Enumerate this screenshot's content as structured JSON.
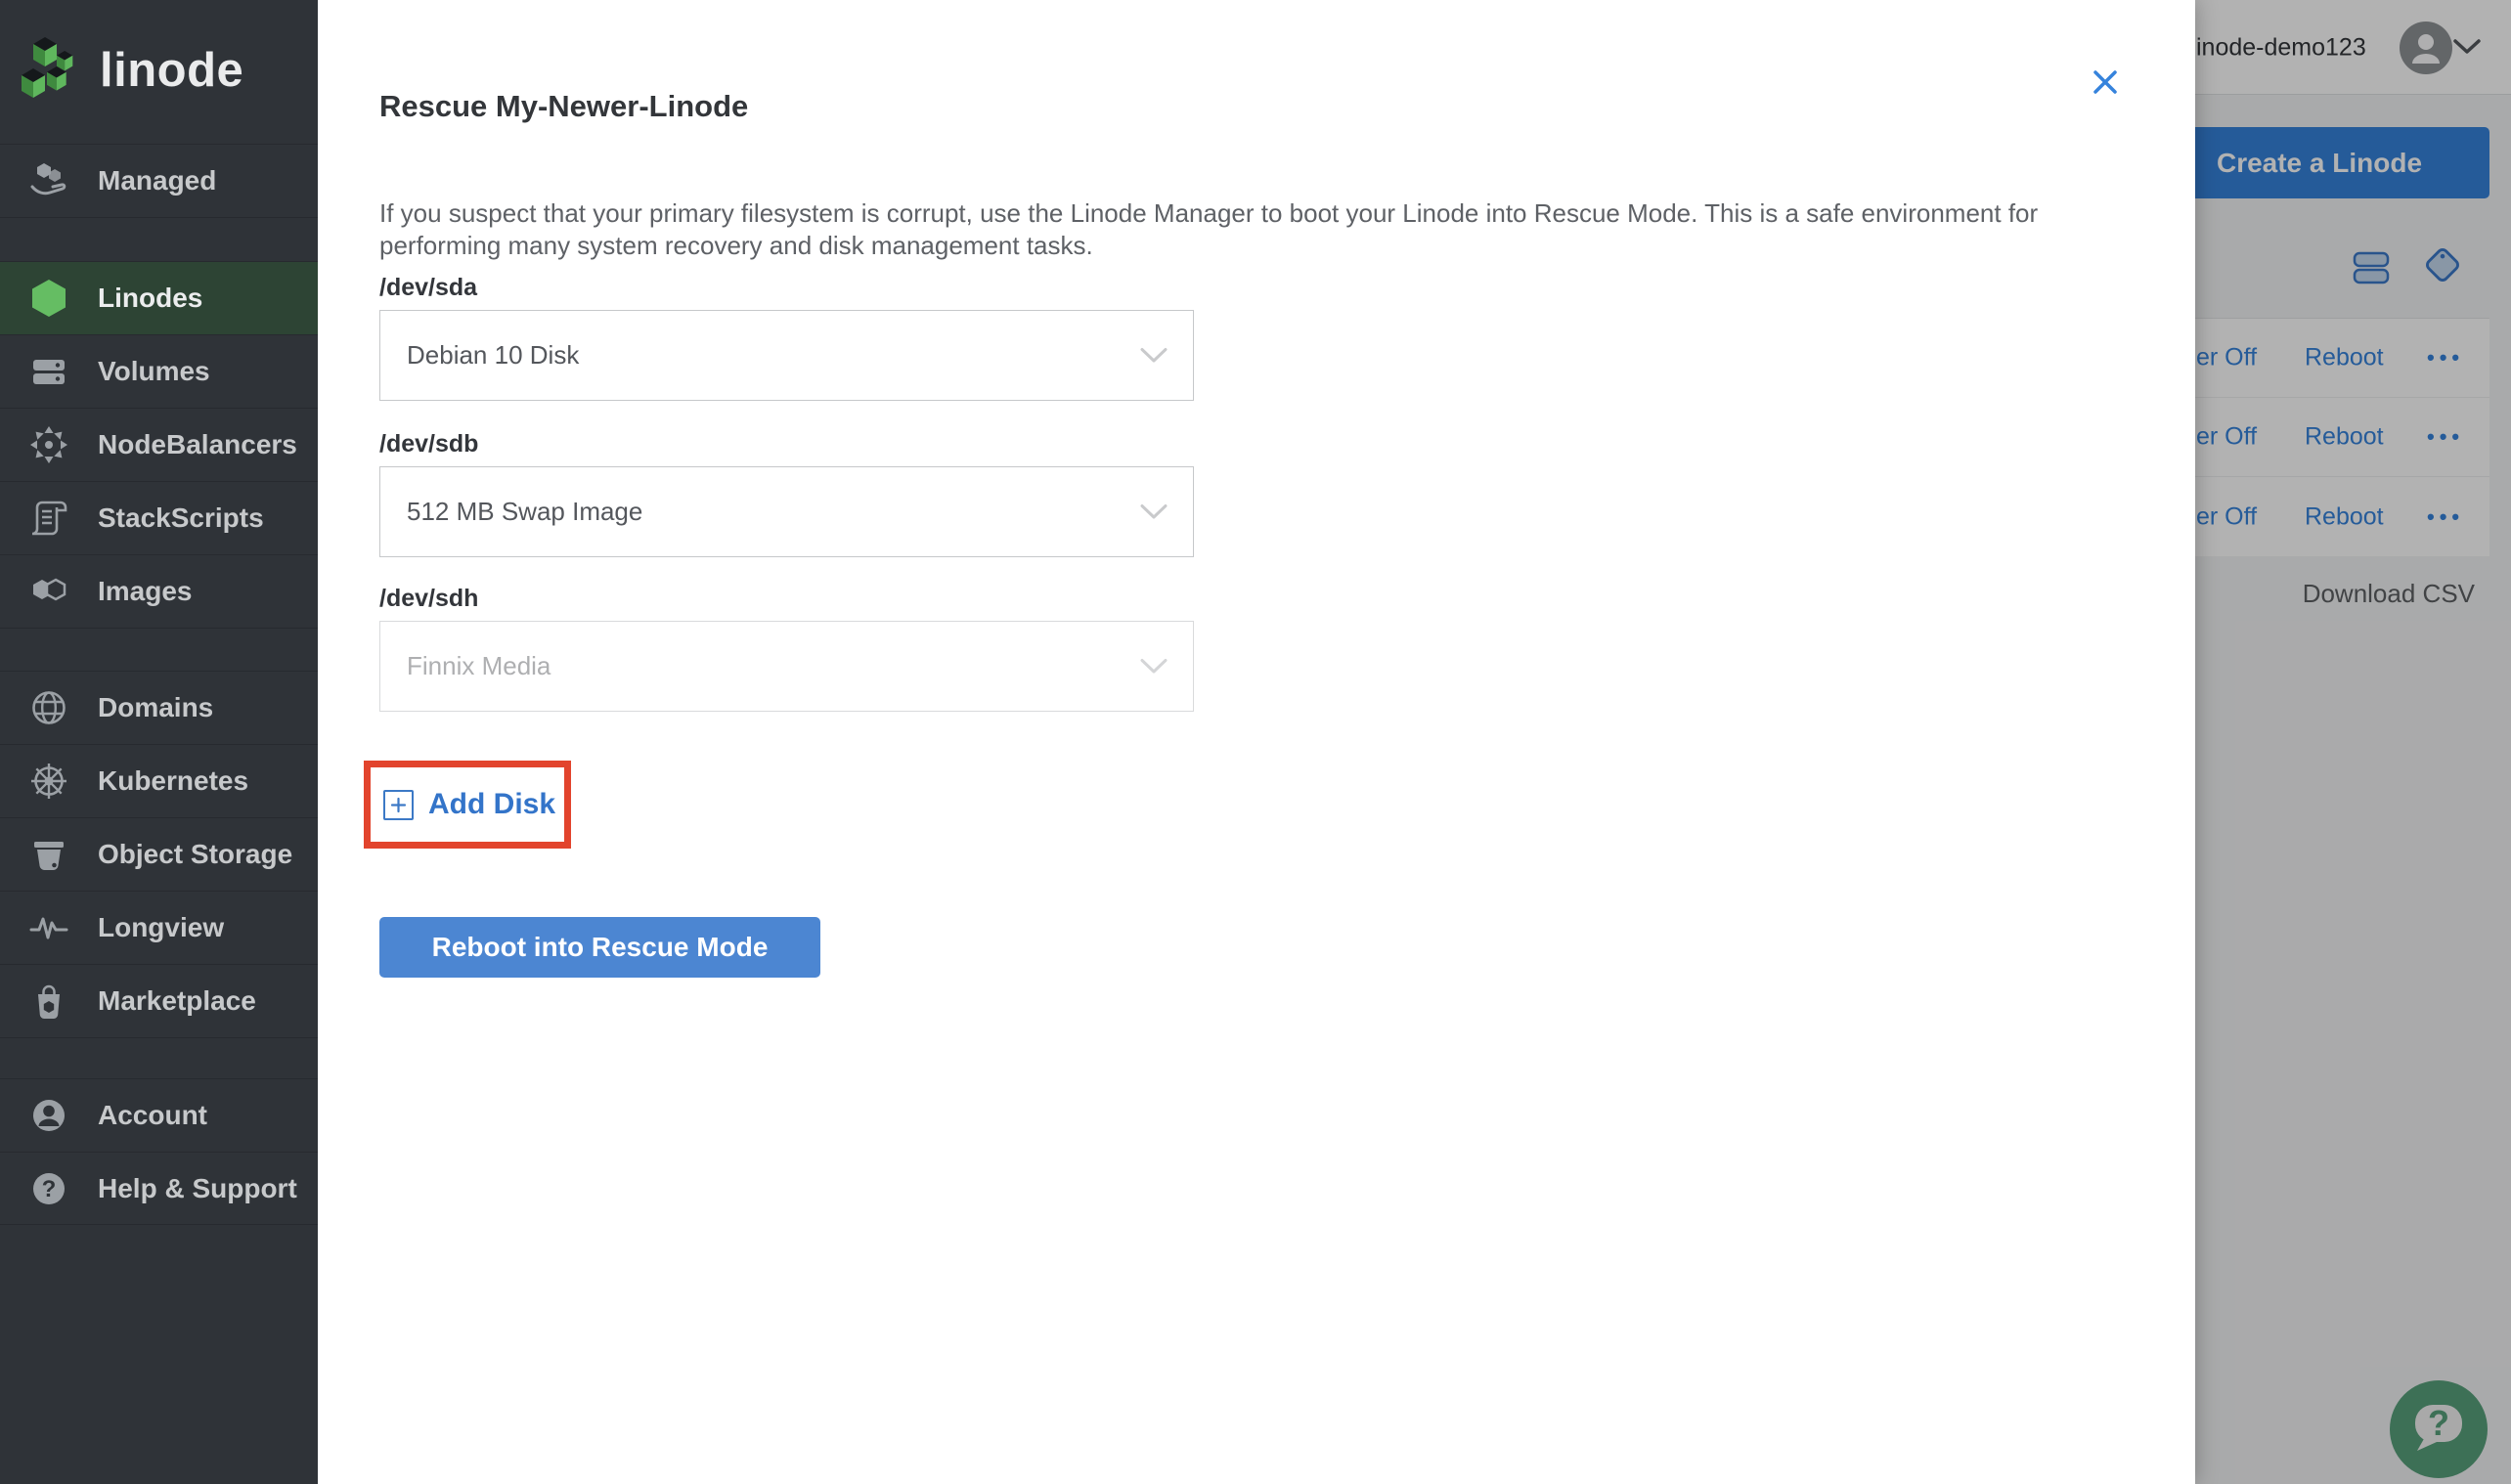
{
  "sidebar": {
    "logo_text": "linode",
    "groups": [
      {
        "items": [
          {
            "label": "Managed"
          }
        ]
      },
      {
        "items": [
          {
            "label": "Linodes",
            "active": true
          },
          {
            "label": "Volumes"
          },
          {
            "label": "NodeBalancers"
          },
          {
            "label": "StackScripts"
          },
          {
            "label": "Images"
          }
        ]
      },
      {
        "items": [
          {
            "label": "Domains"
          },
          {
            "label": "Kubernetes"
          },
          {
            "label": "Object Storage"
          },
          {
            "label": "Longview"
          },
          {
            "label": "Marketplace"
          }
        ]
      },
      {
        "items": [
          {
            "label": "Account"
          },
          {
            "label": "Help & Support"
          }
        ]
      }
    ]
  },
  "modal": {
    "title": "Rescue My-Newer-Linode",
    "description": "If you suspect that your primary filesystem is corrupt, use the Linode Manager to boot your Linode into Rescue Mode. This is a safe environment for performing many system recovery and disk management tasks.",
    "fields": [
      {
        "label": "/dev/sda",
        "value": "Debian 10 Disk",
        "state": "filled"
      },
      {
        "label": "/dev/sdb",
        "value": "512 MB Swap Image",
        "state": "filled"
      },
      {
        "label": "/dev/sdh",
        "value": "Finnix Media",
        "state": "placeholder"
      }
    ],
    "add_disk_label": "Add Disk",
    "submit_label": "Reboot into Rescue Mode"
  },
  "page": {
    "topbar": {
      "username": "inode-demo123"
    },
    "create_button_label": "Create a Linode",
    "rows": [
      {
        "power_label": "er Off",
        "reboot_label": "Reboot",
        "more_label": "•••"
      },
      {
        "power_label": "er Off",
        "reboot_label": "Reboot",
        "more_label": "•••"
      },
      {
        "power_label": "er Off",
        "reboot_label": "Reboot",
        "more_label": "•••"
      }
    ],
    "download_csv_label": "Download CSV"
  },
  "colors": {
    "accent_blue": "#3683dc",
    "highlight_red": "#e2442d",
    "linode_green": "#65bd63",
    "sidebar_bg": "#2f3338",
    "active_item_bg": "#2d4434"
  }
}
